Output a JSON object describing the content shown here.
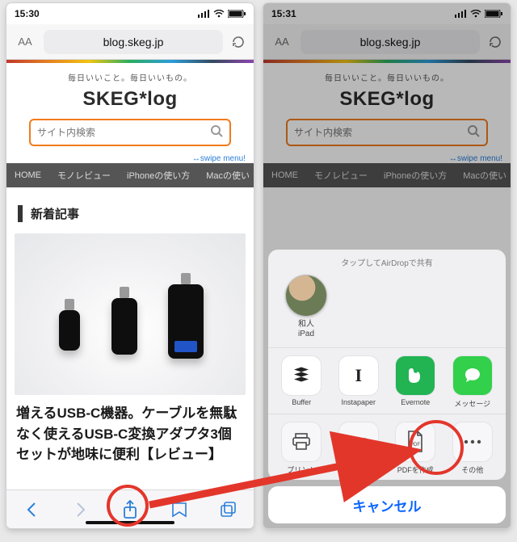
{
  "left": {
    "time": "15:30",
    "url": "blog.skeg.jp",
    "tagline": "毎日いいこと。毎日いいもの。",
    "logo": "SKEG*log",
    "search_placeholder": "サイト内検索",
    "swipe_text": "↔swipe menu!",
    "nav": [
      "HOME",
      "モノレビュー",
      "iPhoneの使い方",
      "Macの使い"
    ],
    "section_title": "新着記事",
    "article_title": "増えるUSB-C機器。ケーブルを無駄なく使えるUSB-C変換アダプタ3個セットが地味に便利【レビュー】"
  },
  "right": {
    "time": "15:31",
    "url": "blog.skeg.jp",
    "tagline": "毎日いいこと。毎日いいもの。",
    "logo": "SKEG*log",
    "search_placeholder": "サイト内検索",
    "swipe_text": "↔swipe menu!",
    "nav": [
      "HOME",
      "モノレビュー",
      "iPhoneの使い方",
      "Macの使い"
    ],
    "share": {
      "airdrop_head": "タップしてAirDropで共有",
      "person": {
        "name_line1": "和人",
        "name_line2": "iPad"
      },
      "apps": [
        {
          "label": "Buffer"
        },
        {
          "label": "Instapaper"
        },
        {
          "label": "Evernote"
        },
        {
          "label": "メッセージ"
        }
      ],
      "actions": [
        {
          "label": "プリント"
        },
        {
          "label": "…に追加"
        },
        {
          "label": "PDFを作成",
          "doc_tag": "PDF"
        },
        {
          "label": "その他"
        }
      ],
      "cancel": "キャンセル"
    }
  }
}
